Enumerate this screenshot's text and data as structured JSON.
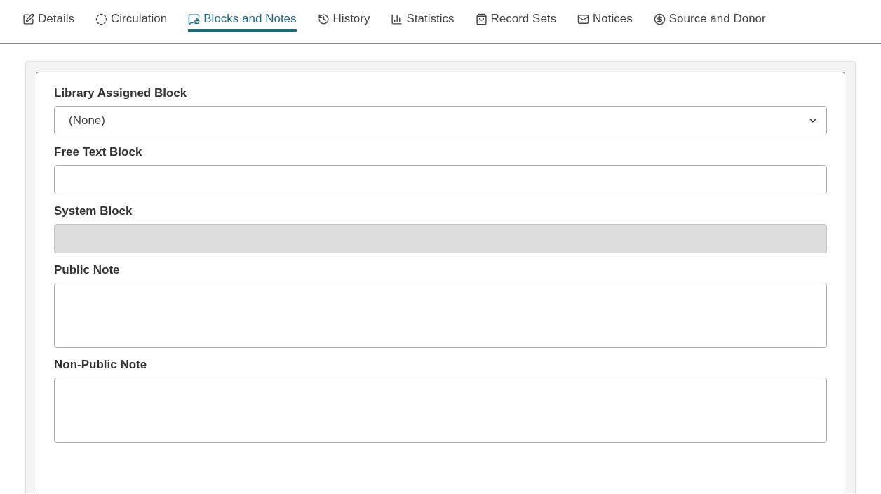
{
  "tabs": [
    {
      "label": "Details",
      "selected": false
    },
    {
      "label": "Circulation",
      "selected": false
    },
    {
      "label": "Blocks and Notes",
      "selected": true
    },
    {
      "label": "History",
      "selected": false
    },
    {
      "label": "Statistics",
      "selected": false
    },
    {
      "label": "Record Sets",
      "selected": false
    },
    {
      "label": "Notices",
      "selected": false
    },
    {
      "label": "Source and Donor",
      "selected": false
    }
  ],
  "fields": [
    {
      "kind": "select",
      "label": "Library Assigned Block",
      "value": "(None)",
      "disabled": false
    },
    {
      "kind": "text",
      "label": "Free Text Block",
      "disabled": false
    },
    {
      "kind": "text",
      "label": "System Block",
      "disabled": true
    },
    {
      "kind": "textarea",
      "label": "Public Note",
      "disabled": false
    },
    {
      "kind": "textarea",
      "label": "Non-Public Note",
      "disabled": false
    }
  ]
}
